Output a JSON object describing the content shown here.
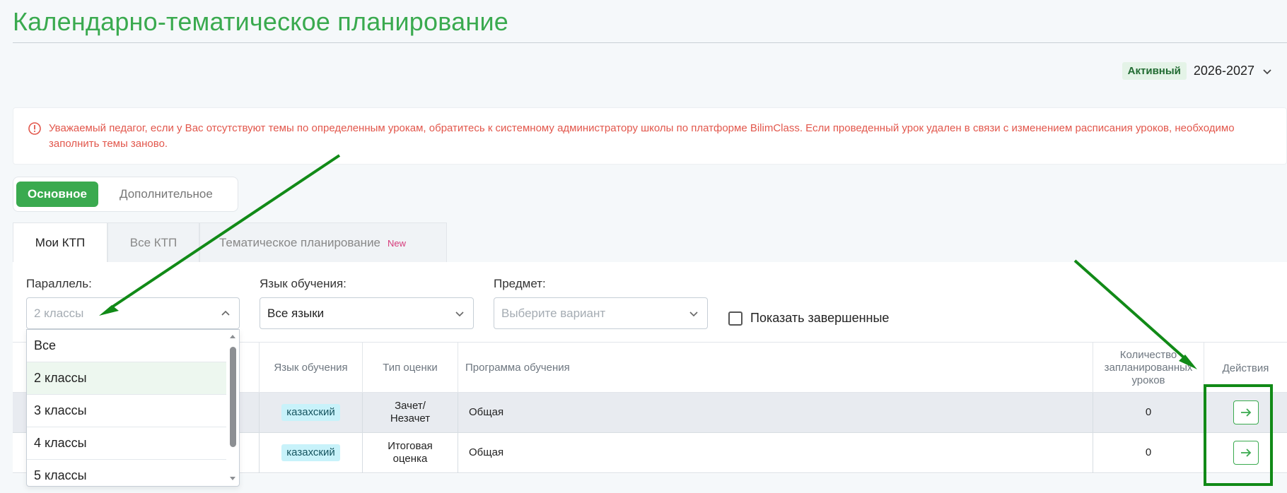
{
  "page": {
    "title": "Календарно-тематическое планирование"
  },
  "year": {
    "status": "Активный",
    "value": "2026-2027"
  },
  "alert": {
    "text": "Уважаемый педагог, если у Вас отсутствуют темы по определенным урокам, обратитесь к системному администратору школы по платформе BilimClass. Если проведенный урок удален в связи с изменением расписания уроков, необходимо заполнить темы заново."
  },
  "segment": {
    "active": "Основное",
    "inactive": "Дополнительное"
  },
  "tabs": [
    {
      "label": "Мои КТП"
    },
    {
      "label": "Все КТП"
    },
    {
      "label": "Тематическое планирование",
      "badge": "New"
    }
  ],
  "filters": {
    "parallel": {
      "label": "Параллель:",
      "value": "2 классы"
    },
    "language": {
      "label": "Язык обучения:",
      "value": "Все языки"
    },
    "subject": {
      "label": "Предмет:",
      "placeholder": "Выберите вариант"
    },
    "show_completed": "Показать завершенные"
  },
  "dropdown": {
    "options": [
      "Все",
      "2 классы",
      "3 классы",
      "4 классы",
      "5 классы"
    ],
    "selected": "2 классы"
  },
  "table": {
    "headers": {
      "language": "Язык обучения",
      "grade_type": "Тип оценки",
      "program": "Программа обучения",
      "planned_a": "Количество",
      "planned_b": "запланированных",
      "planned_c": "уроков",
      "actions": "Действия"
    },
    "rows": [
      {
        "language": "казахский",
        "grade_type_a": "Зачет/",
        "grade_type_b": "Незачет",
        "program": "Общая",
        "planned": "0"
      },
      {
        "language": "казахский",
        "grade_type_a": "Итоговая",
        "grade_type_b": "оценка",
        "program": "Общая",
        "planned": "0"
      }
    ]
  },
  "colors": {
    "brand": "#3aaa4f",
    "alert": "#e2574c",
    "annotation": "#118a17"
  }
}
